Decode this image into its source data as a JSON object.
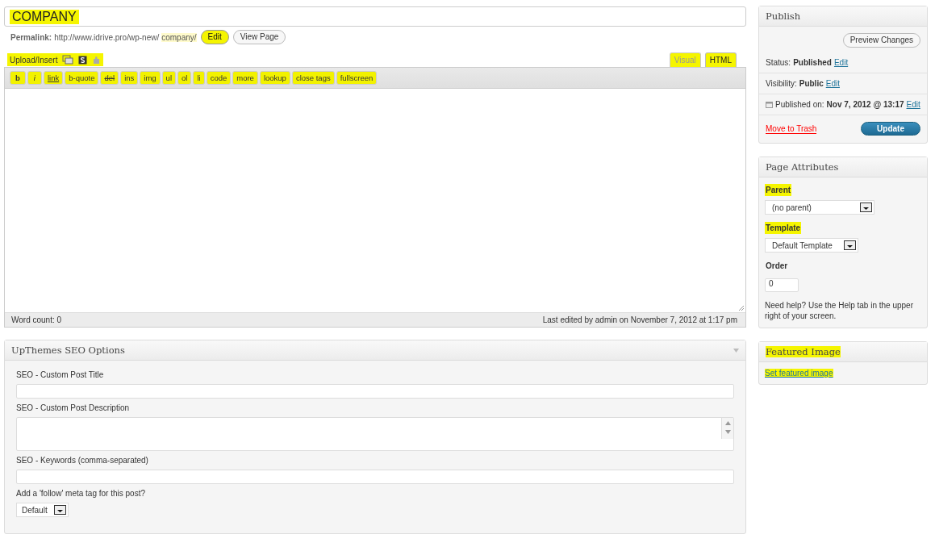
{
  "title": {
    "value": "COMPANY",
    "highlighted": true
  },
  "permalink": {
    "label": "Permalink:",
    "url": "http://www.idrive.pro/wp-new/",
    "slug": "company/",
    "buttons": [
      {
        "label": "Edit",
        "highlighted": true
      },
      {
        "label": "View Page",
        "highlighted": false
      }
    ]
  },
  "media": {
    "label": "Upload/Insert",
    "highlighted": true
  },
  "editor_tabs": [
    {
      "label": "Visual",
      "selected": false,
      "highlighted": true
    },
    {
      "label": "HTML",
      "selected": true,
      "highlighted": true
    }
  ],
  "quicktags": [
    {
      "label": "b",
      "kind": "bold"
    },
    {
      "label": "i",
      "kind": "italic"
    },
    {
      "label": "link",
      "kind": "underline"
    },
    {
      "label": "b-quote",
      "kind": "plain"
    },
    {
      "label": "del",
      "kind": "strike"
    },
    {
      "label": "ins",
      "kind": "plain"
    },
    {
      "label": "img",
      "kind": "plain"
    },
    {
      "label": "ul",
      "kind": "plain"
    },
    {
      "label": "ol",
      "kind": "plain"
    },
    {
      "label": "li",
      "kind": "plain"
    },
    {
      "label": "code",
      "kind": "plain"
    },
    {
      "label": "more",
      "kind": "plain"
    },
    {
      "label": "lookup",
      "kind": "plain"
    },
    {
      "label": "close tags",
      "kind": "plain"
    },
    {
      "label": "fullscreen",
      "kind": "plain"
    }
  ],
  "quicktags_highlighted": true,
  "status_bar": {
    "word_count": "Word count: 0",
    "last_edited": "Last edited by admin on November 7, 2012 at 1:17 pm"
  },
  "seo_box": {
    "title": "UpThemes SEO Options",
    "fields": [
      {
        "kind": "input",
        "label": "SEO - Custom Post Title"
      },
      {
        "kind": "textarea",
        "label": "SEO - Custom Post Description"
      },
      {
        "kind": "input",
        "label": "SEO - Keywords (comma-separated)"
      },
      {
        "kind": "select",
        "label": "Add a 'follow' meta tag for this post?",
        "value": "Default"
      }
    ]
  },
  "publish": {
    "title": "Publish",
    "preview_button": "Preview Changes",
    "rows": [
      {
        "kind": "plain",
        "label": "Status:",
        "value": "Published",
        "link": "Edit"
      },
      {
        "kind": "plain",
        "label": "Visibility:",
        "value": "Public",
        "link": "Edit"
      },
      {
        "kind": "calendar",
        "label": "Published on:",
        "value": "Nov 7, 2012 @ 13:17",
        "link": "Edit"
      }
    ],
    "trash": "Move to Trash",
    "update": "Update"
  },
  "page_attributes": {
    "title": "Page Attributes",
    "fields": [
      {
        "kind": "select",
        "label": "Parent",
        "value": "(no parent)",
        "highlighted": true
      },
      {
        "kind": "select",
        "label": "Template",
        "value": "Default Template",
        "highlighted": true
      },
      {
        "kind": "input",
        "label": "Order",
        "value": "0",
        "highlighted": false
      }
    ],
    "help": "Need help? Use the Help tab in the upper right of your screen."
  },
  "featured_image": {
    "title": "Featured Image",
    "link": "Set featured image",
    "highlighted": true
  }
}
